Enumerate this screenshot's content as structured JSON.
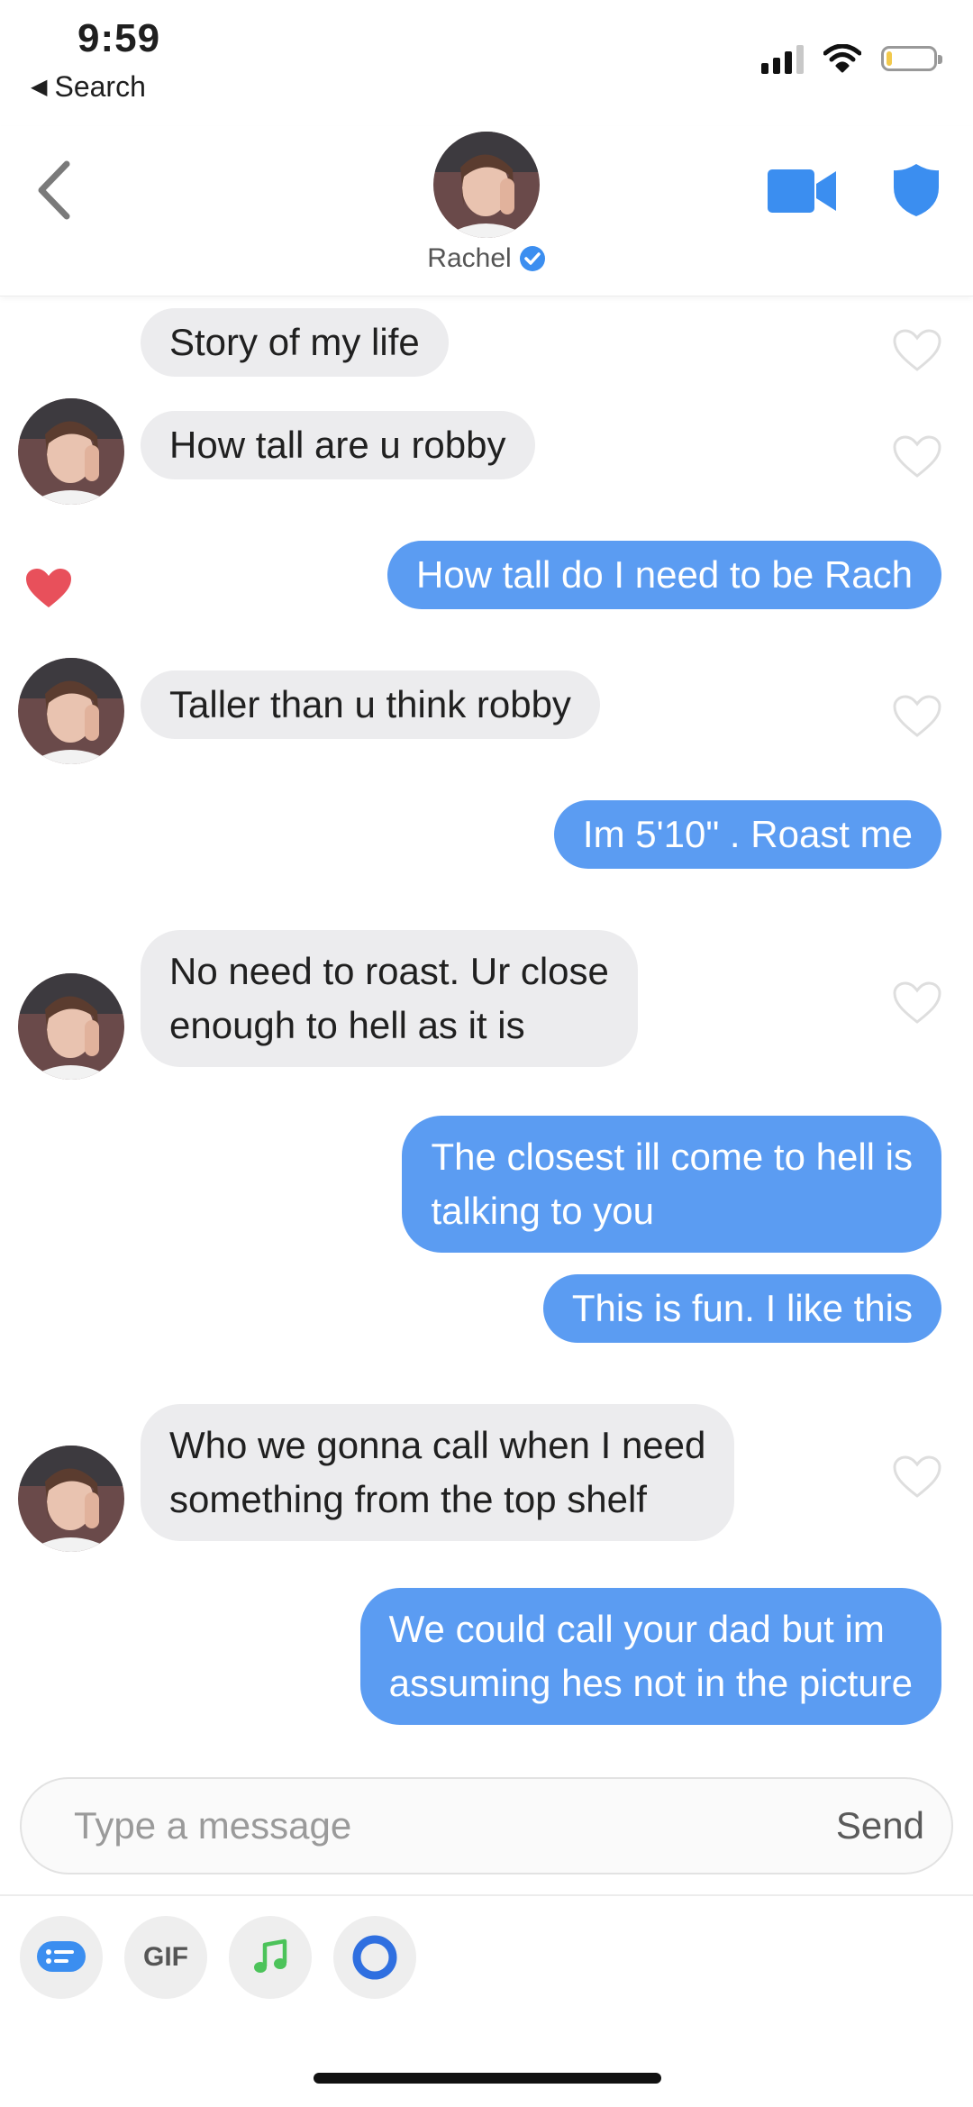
{
  "status": {
    "time": "9:59",
    "back_app": "Search"
  },
  "header": {
    "name": "Rachel"
  },
  "messages": [
    {
      "from": "them",
      "lines": [
        "Story of my life"
      ]
    },
    {
      "from": "them",
      "lines": [
        "How tall are u robby"
      ]
    },
    {
      "from": "me",
      "lines": [
        "How tall do I need to be Rach"
      ],
      "liked": true
    },
    {
      "from": "them",
      "lines": [
        "Taller than u think robby"
      ]
    },
    {
      "from": "me",
      "lines": [
        "Im 5'10\" . Roast me"
      ]
    },
    {
      "from": "them",
      "lines": [
        "No need to roast. Ur close",
        "enough to hell as it is"
      ]
    },
    {
      "from": "me",
      "lines": [
        "The closest ill come to hell is",
        "talking to you"
      ]
    },
    {
      "from": "me",
      "lines": [
        "This is fun. I like this"
      ]
    },
    {
      "from": "them",
      "lines": [
        "Who we gonna call when I need",
        "something from the top shelf"
      ]
    },
    {
      "from": "me",
      "lines": [
        "We could call your dad but im",
        "assuming hes not in the picture"
      ]
    }
  ],
  "composer": {
    "placeholder": "Type a message",
    "send_label": "Send"
  },
  "toolbar": {
    "gif_label": "GIF"
  },
  "colors": {
    "accent": "#5b9cf2",
    "heart_liked": "#e8505b",
    "bubble_in": "#ececee"
  }
}
